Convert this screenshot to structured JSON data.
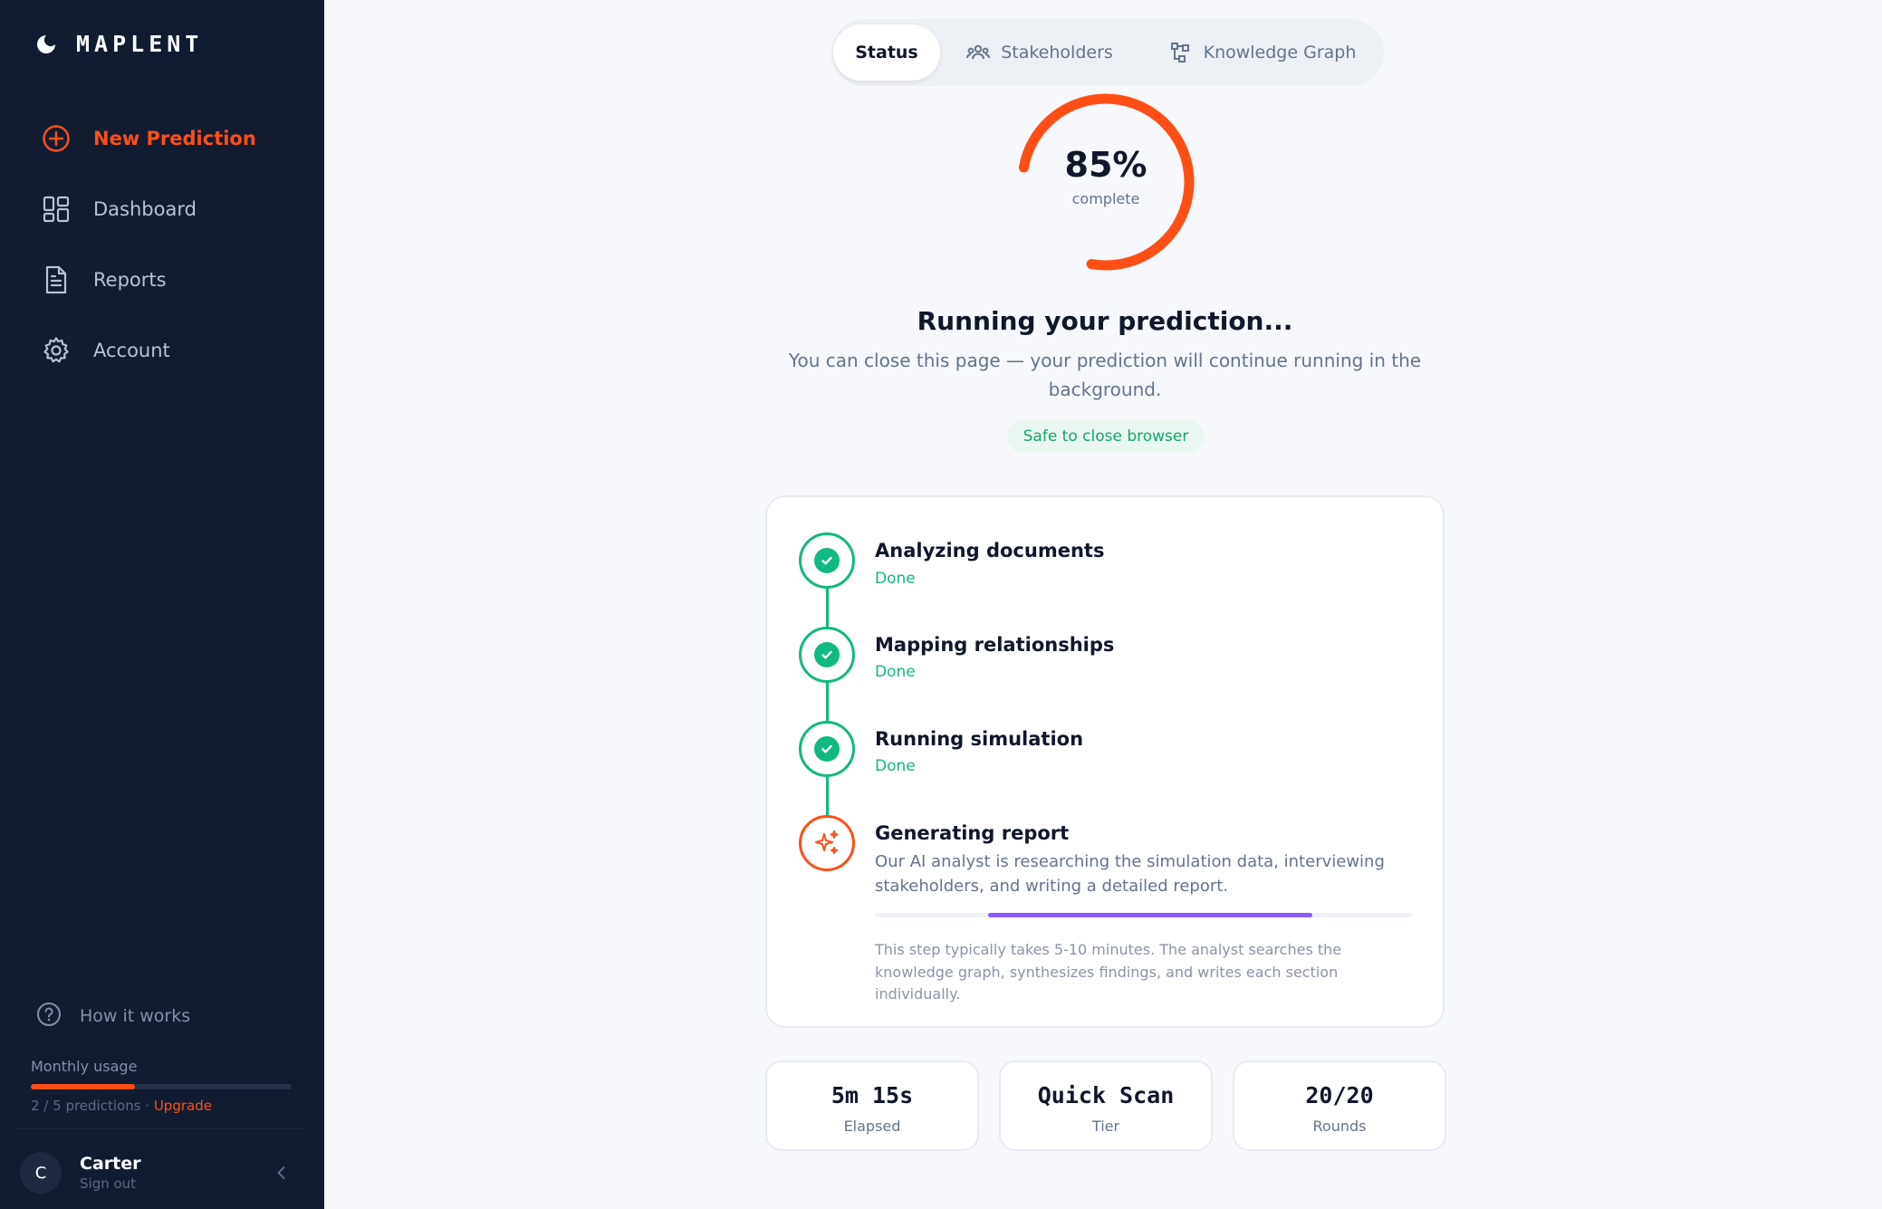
{
  "app": {
    "name": "MAPLENT"
  },
  "sidebar": {
    "items": [
      {
        "label": "New Prediction",
        "icon": "plus-circle-icon",
        "active": true
      },
      {
        "label": "Dashboard",
        "icon": "dashboard-grid-icon",
        "active": false
      },
      {
        "label": "Reports",
        "icon": "document-icon",
        "active": false
      },
      {
        "label": "Account",
        "icon": "gear-icon",
        "active": false
      }
    ],
    "help": {
      "label": "How it works",
      "icon": "question-circle-icon"
    },
    "usage": {
      "title": "Monthly usage",
      "used": 2,
      "limit": 5,
      "text": "2 / 5 predictions · ",
      "upgrade": "Upgrade"
    },
    "user": {
      "initial": "C",
      "name": "Carter",
      "signout": "Sign out"
    }
  },
  "tabs": [
    {
      "label": "Status",
      "active": true,
      "icon": ""
    },
    {
      "label": "Stakeholders",
      "active": false,
      "icon": "users-icon"
    },
    {
      "label": "Knowledge Graph",
      "active": false,
      "icon": "graph-icon"
    }
  ],
  "progress": {
    "percent": 85,
    "percent_text": "85%",
    "sub": "complete"
  },
  "status": {
    "headline": "Running your prediction...",
    "subline": "You can close this page — your prediction will continue running in the background.",
    "safe_badge": "Safe to close browser"
  },
  "steps": [
    {
      "title": "Analyzing documents",
      "status": "Done",
      "state": "done"
    },
    {
      "title": "Mapping relationships",
      "status": "Done",
      "state": "done"
    },
    {
      "title": "Running simulation",
      "status": "Done",
      "state": "done"
    },
    {
      "title": "Generating report",
      "state": "current",
      "description": "Our AI analyst is researching the simulation data, interviewing stakeholders, and writing a detailed report.",
      "note": "This step typically takes 5-10 minutes. The analyst searches the knowledge graph, synthesizes findings, and writes each section individually."
    }
  ],
  "stats": [
    {
      "value": "5m 15s",
      "label": "Elapsed"
    },
    {
      "value": "Quick Scan",
      "label": "Tier"
    },
    {
      "value": "20/20",
      "label": "Rounds"
    }
  ],
  "colors": {
    "accent": "#ff4f16",
    "success": "#10b981",
    "sidebar": "#111c31",
    "progress_purple": "#8b5cf6"
  }
}
